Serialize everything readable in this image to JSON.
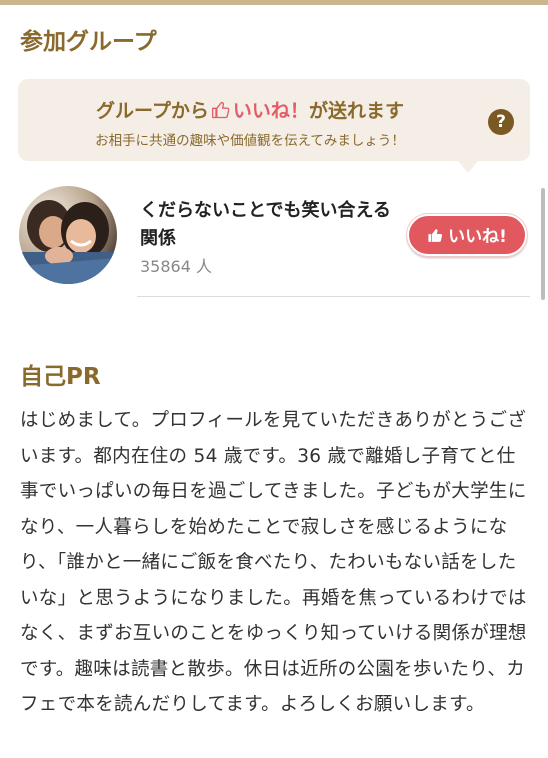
{
  "groups_section": {
    "title": "参加グループ"
  },
  "like_banner": {
    "line1_before": "グループから",
    "line1_like": "いいね！",
    "line1_after": "が送れます",
    "line2": "お相手に共通の趣味や価値観を伝えてみましょう！",
    "help_icon": "question-icon",
    "help_symbol": "?"
  },
  "group": {
    "name": "くだらないことでも笑い合える関係",
    "count": "35864 人",
    "like_button_label": "いいね!"
  },
  "pr_section": {
    "title": "自己PR",
    "text": "はじめまして。プロフィールを見ていただきありがとうございます。都内在住の 54 歳です。36 歳で離婚し子育てと仕事でいっぱいの毎日を過ごしてきました。子どもが大学生になり、一人暮らしを始めたことで寂しさを感じるようになり、「誰かと一緒にご飯を食べたり、たわいもない話をしたいな」と思うようになりました。再婚を焦っているわけではなく、まずお互いのことをゆっくり知っていける関係が理想です。趣味は読書と散歩。休日は近所の公園を歩いたり、カフェで本を読んだりしてます。よろしくお願いします。"
  },
  "colors": {
    "accent_brown": "#8a6a2c",
    "like_pink": "#e1585e",
    "banner_bg": "#f4eee7"
  }
}
